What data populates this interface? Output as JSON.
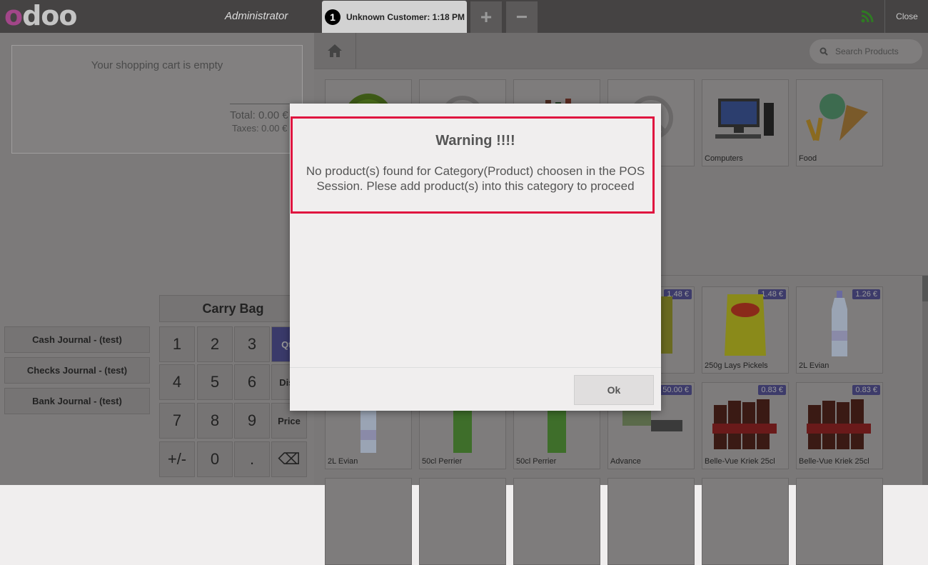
{
  "header": {
    "logo": "odoo",
    "user": "Administrator",
    "order_number": "1",
    "order_label": "Unknown Customer: 1:18 PM",
    "add_label": "+",
    "remove_label": "−",
    "close_label": "Close"
  },
  "cart": {
    "empty_text": "Your shopping cart is empty",
    "total": "Total: 0.00 €",
    "taxes": "Taxes: 0.00 €"
  },
  "journals": [
    "Cash Journal - (test)",
    "Checks Journal - (test)",
    "Bank Journal - (test)"
  ],
  "numpad": {
    "carry_bag": "Carry Bag",
    "keys": [
      "1",
      "2",
      "3",
      "4",
      "5",
      "6",
      "7",
      "8",
      "9",
      "+/-",
      "0",
      "."
    ],
    "modes": [
      "Qty",
      "Disc",
      "Price"
    ],
    "backspace": "⌫"
  },
  "search": {
    "placeholder": "Search Products"
  },
  "categories": [
    {
      "name": ""
    },
    {
      "name": ""
    },
    {
      "name": ""
    },
    {
      "name": ""
    },
    {
      "name": "Computers"
    },
    {
      "name": "Food"
    }
  ],
  "products": [
    {
      "name": "",
      "price": "1.48 €"
    },
    {
      "name": "250g Lays Pickels",
      "price": "1.48 €"
    },
    {
      "name": "2L Evian",
      "price": "1.26 €"
    },
    {
      "name": "2L Evian",
      "price": ""
    },
    {
      "name": "50cl Perrier",
      "price": ""
    },
    {
      "name": "50cl Perrier",
      "price": ""
    },
    {
      "name": "Advance",
      "price": "50.00 €"
    },
    {
      "name": "Belle-Vue Kriek 25cl",
      "price": "0.83 €"
    },
    {
      "name": "Belle-Vue Kriek 25cl",
      "price": "0.83 €"
    }
  ],
  "modal": {
    "title": "Warning !!!!",
    "message": "No product(s) found for Category(Product) choosen in the POS Session. Plese add product(s) into this category to proceed",
    "ok_label": "Ok"
  },
  "colors": {
    "highlight_border": "#e0153f",
    "brand_purple": "#a24689"
  }
}
